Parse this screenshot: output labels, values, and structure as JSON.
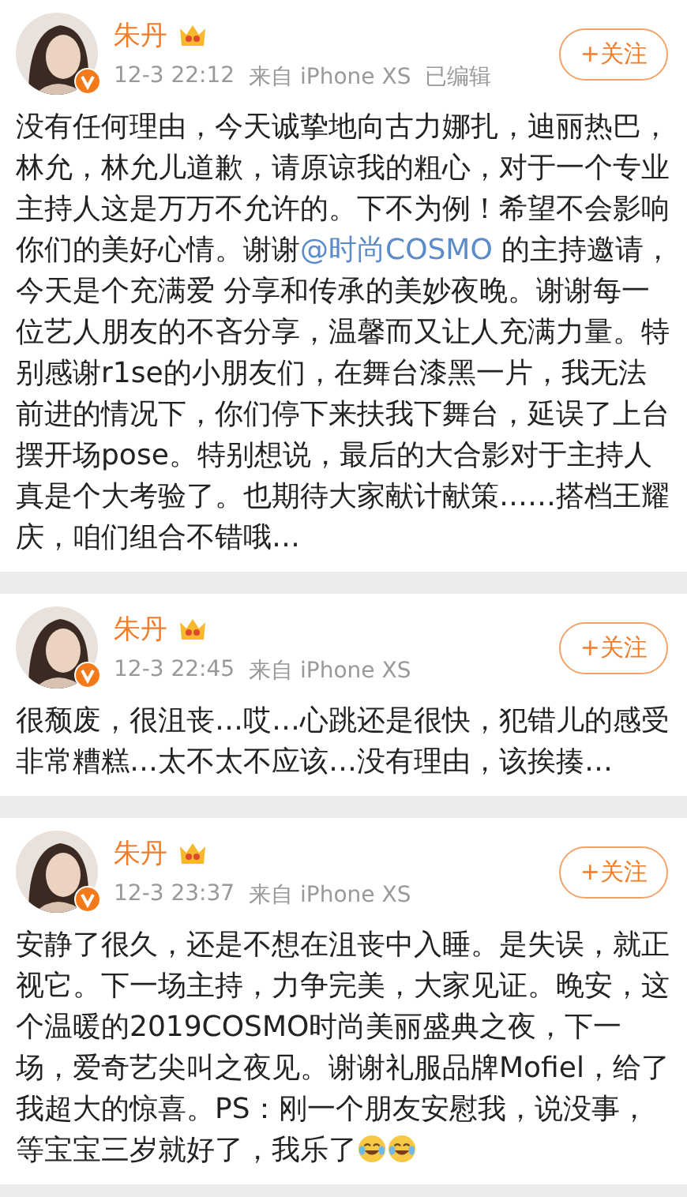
{
  "posts": [
    {
      "author": "朱丹",
      "vip": true,
      "verified": true,
      "time": "12-3 22:12",
      "source": "来自 iPhone XS",
      "edited": "已编辑",
      "follow_button": "+关注",
      "segments": [
        {
          "kind": "plain",
          "text": "没有任何理由，今天诚挚地向古力娜扎，迪丽热巴，林允，林允儿道歉，请原谅我的粗心，对于一个专业主持人这是万万不允许的。下不为例！希望不会影响你们的美好心情。谢谢"
        },
        {
          "kind": "mention",
          "text": "@时尚COSMO"
        },
        {
          "kind": "plain",
          "text": " 的主持邀请，今天是个充满爱 分享和传承的美妙夜晚。谢谢每一位艺人朋友的不吝分享，温馨而又让人充满力量。特别感谢r1se的小朋友们，在舞台漆黑一片，我无法前进的情况下，你们停下来扶我下舞台，延误了上台摆开场pose。特别想说，最后的大合影对于主持人真是个大考验了。也期待大家献计献策……搭档王耀庆，咱们组合不错哦…"
        }
      ]
    },
    {
      "author": "朱丹",
      "vip": true,
      "verified": true,
      "time": "12-3 22:45",
      "source": "来自 iPhone XS",
      "follow_button": "+关注",
      "segments": [
        {
          "kind": "plain",
          "text": "很颓废，很沮丧…哎…心跳还是很快，犯错儿的感受非常糟糕…太不太不应该…没有理由，该挨揍…"
        }
      ]
    },
    {
      "author": "朱丹",
      "vip": true,
      "verified": true,
      "time": "12-3 23:37",
      "source": "来自 iPhone XS",
      "follow_button": "+关注",
      "segments": [
        {
          "kind": "plain",
          "text": "安静了很久，还是不想在沮丧中入睡。是失误，就正视它。下一场主持，力争完美，大家见证。晚安，这个温暖的2019COSMO时尚美丽盛典之夜，下一场，爱奇艺尖叫之夜见。谢谢礼服品牌Mofiel，给了我超大的惊喜。PS：刚一个朋友安慰我，说没事，等宝宝三岁就好了，我乐了"
        }
      ],
      "emojis": [
        {
          "kind": "laugh-cry"
        },
        {
          "kind": "laugh-cry"
        }
      ]
    }
  ]
}
